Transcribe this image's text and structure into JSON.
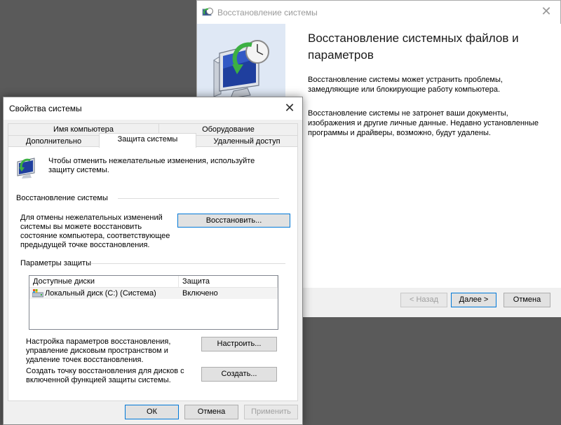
{
  "restore_wizard": {
    "title": "Восстановление системы",
    "heading": "Восстановление системных файлов и параметров",
    "para1": "Восстановление системы может устранить проблемы, замедляющие или блокирующие работу компьютера.",
    "para2": "Восстановление системы не затронет ваши документы, изображения и другие личные данные. Недавно установленные программы и драйверы, возможно, будут удалены.",
    "buttons": {
      "back": "< Назад",
      "next": "Далее >",
      "cancel": "Отмена"
    }
  },
  "system_properties": {
    "title": "Свойства системы",
    "tabs": {
      "computer_name": "Имя компьютера",
      "hardware": "Оборудование",
      "advanced": "Дополнительно",
      "protection": "Защита системы",
      "remote": "Удаленный доступ"
    },
    "intro": "Чтобы отменить нежелательные изменения, используйте защиту системы.",
    "restore_group": {
      "label": "Восстановление системы",
      "description": "Для отмены нежелательных изменений системы вы можете восстановить состояние компьютера, соответствующее предыдущей точке восстановления.",
      "button": "Восстановить..."
    },
    "protection_group": {
      "label": "Параметры защиты",
      "columns": [
        "Доступные диски",
        "Защита"
      ],
      "rows": [
        {
          "drive": "Локальный диск (C:) (Система)",
          "status": "Включено"
        }
      ]
    },
    "configure": {
      "description": "Настройка параметров восстановления, управление дисковым пространством и удаление точек восстановления.",
      "button": "Настроить..."
    },
    "create": {
      "description": "Создать точку восстановления для дисков с включенной функцией защиты системы.",
      "button": "Создать..."
    },
    "footer": {
      "ok": "ОК",
      "cancel": "Отмена",
      "apply": "Применить"
    }
  },
  "icons": {
    "window_icon": "system-restore-icon",
    "close": "close-icon",
    "drive": "drive-icon"
  }
}
